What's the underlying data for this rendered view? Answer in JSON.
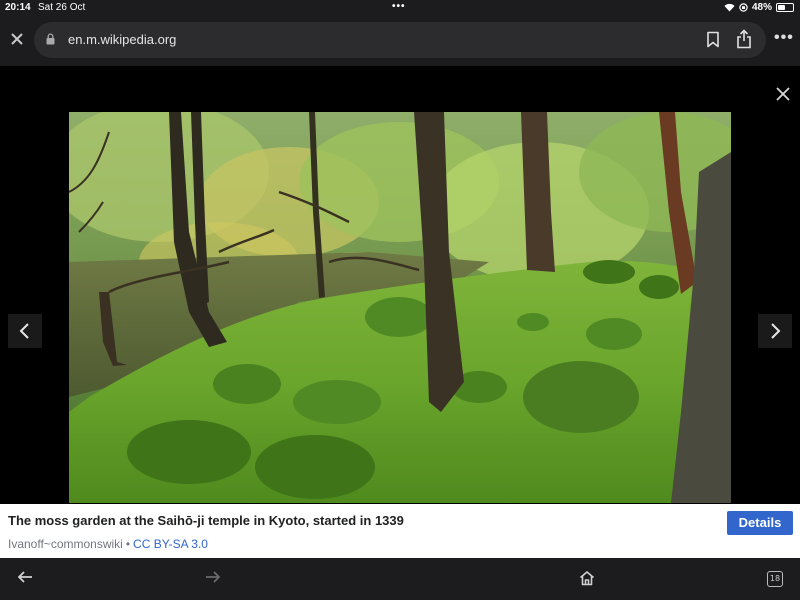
{
  "status_bar": {
    "time": "20:14",
    "date": "Sat 26 Oct",
    "battery": "48%",
    "battery_level": 0.48
  },
  "browser": {
    "url": "en.m.wikipedia.org",
    "icons": [
      "close-icon",
      "lock-icon",
      "bookmark-icon",
      "share-icon",
      "more-icon",
      "back-icon",
      "forward-icon",
      "home-icon",
      "tabs-icon"
    ],
    "tab_count": "18"
  },
  "media_viewer": {
    "icons": [
      "close-icon",
      "chevron-left-icon",
      "chevron-right-icon"
    ],
    "caption": "The moss garden at the Saihō-ji temple in Kyoto, started in 1339",
    "author": "Ivanoff~commonswiki",
    "separator": "•",
    "license": "CC BY-SA 3.0",
    "details_label": "Details"
  },
  "colors": {
    "accent": "#3366cc",
    "chrome": "#1c1c1e",
    "field": "#2c2c2e"
  }
}
